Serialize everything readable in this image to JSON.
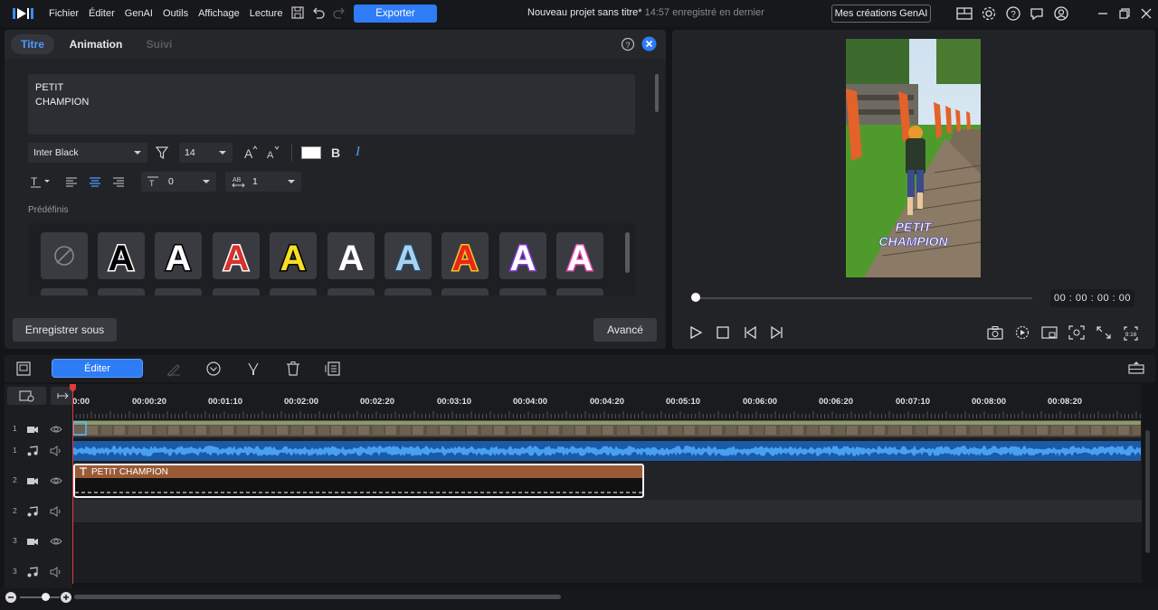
{
  "menu": [
    "Fichier",
    "Éditer",
    "GenAI",
    "Outils",
    "Affichage",
    "Lecture"
  ],
  "export_label": "Exporter",
  "project": {
    "title": "Nouveau projet sans titre*",
    "saved": "14:57 enregistré en dernier"
  },
  "genai_button": "Mes créations GenAI",
  "tabs": {
    "title": "Titre",
    "animation": "Animation",
    "follow": "Suivi"
  },
  "text_content": {
    "line1": "PETIT",
    "line2": "CHAMPION"
  },
  "format": {
    "font": "Inter Black",
    "size": "14",
    "spacing": "0",
    "line_spacing": "1",
    "color": "#ffffff"
  },
  "presets_label": "Prédéfinis",
  "presets": [
    {
      "glyph": "A",
      "fill": "#ffffff",
      "stroke": "#000000",
      "bg": "#3a3b40"
    },
    {
      "glyph": "A",
      "fill": "#000000",
      "stroke": "#ffffff",
      "bg": "#3a3b40"
    },
    {
      "glyph": "A",
      "fill": "#ffffff",
      "stroke": "#000000",
      "bg": "#3a3b40"
    },
    {
      "glyph": "A",
      "fill": "#d8322b",
      "stroke": "#ffffff",
      "bg": "#3a3b40"
    },
    {
      "glyph": "A",
      "fill": "#f4df22",
      "stroke": "#000000",
      "bg": "#3a3b40"
    },
    {
      "glyph": "A",
      "fill": "#ffffff",
      "stroke": "#3a3b40",
      "bg": "#3a3b40"
    },
    {
      "glyph": "A",
      "fill": "#a8d4f0",
      "stroke": "#2a4a6a",
      "bg": "#3a3b40"
    },
    {
      "glyph": "A",
      "fill": "#e8261e",
      "stroke": "#f4c81e",
      "bg": "#3a3b40"
    },
    {
      "glyph": "A",
      "fill": "#ffffff",
      "stroke": "#8a3ad8",
      "bg": "#3a3b40"
    },
    {
      "glyph": "A",
      "fill": "#ffffff",
      "stroke": "#e84ab8",
      "bg": "#3a3b40"
    }
  ],
  "save_as": "Enregistrer sous",
  "advanced": "Avancé",
  "preview": {
    "overlay_line1": "PETIT",
    "overlay_line2": "CHAMPION",
    "timecode": "00 : 00 : 00 : 00",
    "progress": 0
  },
  "timeline": {
    "edit_label": "Éditer",
    "ruler": [
      "0:00",
      "00:00:20",
      "00:01:10",
      "00:02:00",
      "00:02:20",
      "00:03:10",
      "00:04:00",
      "00:04:20",
      "00:05:10",
      "00:06:00",
      "00:06:20",
      "00:07:10",
      "00:08:00",
      "00:08:20"
    ],
    "tracks": [
      {
        "num": "1",
        "type": "video"
      },
      {
        "num": "1",
        "type": "audio"
      },
      {
        "num": "2",
        "type": "video"
      },
      {
        "num": "2",
        "type": "audio"
      },
      {
        "num": "3",
        "type": "video"
      },
      {
        "num": "3",
        "type": "audio"
      }
    ],
    "title_clip": "PETIT CHAMPION"
  },
  "colors": {
    "accent": "#2e7cf6",
    "clip": "#9a5a36",
    "audio": "#2a7ad8",
    "playhead": "#e23b3b"
  }
}
